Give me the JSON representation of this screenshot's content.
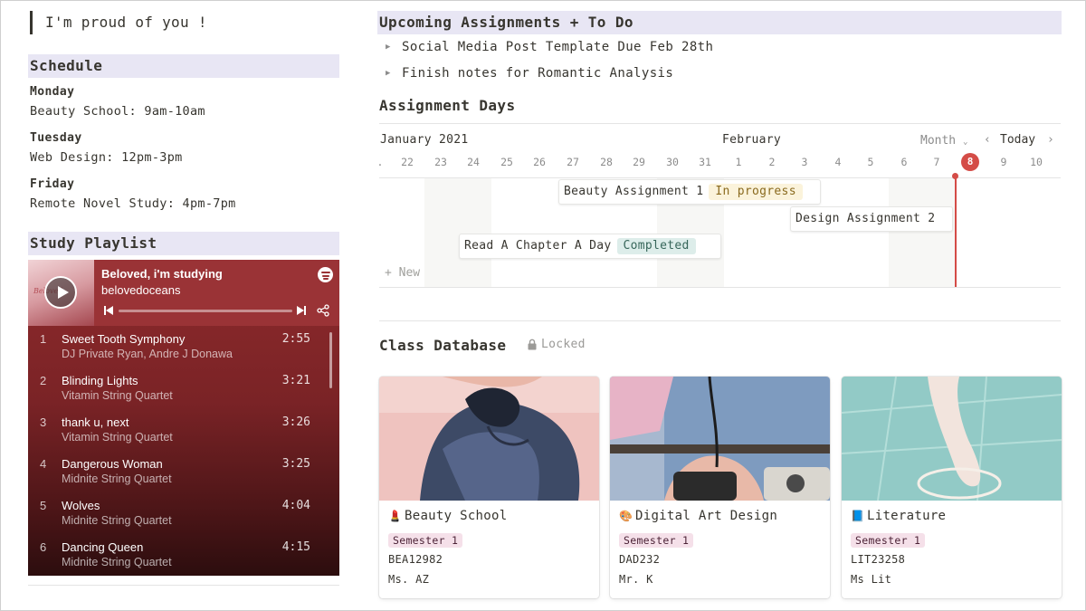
{
  "quote": "I'm proud of you !",
  "schedule": {
    "heading": "Schedule",
    "days": [
      {
        "day": "Monday",
        "slot": "Beauty School: 9am-10am"
      },
      {
        "day": "Tuesday",
        "slot": "Web Design: 12pm-3pm"
      },
      {
        "day": "Friday",
        "slot": "Remote Novel Study: 4pm-7pm"
      }
    ]
  },
  "playlist": {
    "heading": "Study Playlist",
    "title": "Beloved, i'm studying",
    "owner": "belovedoceans",
    "tracks": [
      {
        "num": "1",
        "name": "Sweet Tooth Symphony",
        "artist": "DJ Private Ryan, Andre J Donawa",
        "duration": "2:55"
      },
      {
        "num": "2",
        "name": "Blinding Lights",
        "artist": "Vitamin String Quartet",
        "duration": "3:21"
      },
      {
        "num": "3",
        "name": "thank u, next",
        "artist": "Vitamin String Quartet",
        "duration": "3:26"
      },
      {
        "num": "4",
        "name": "Dangerous Woman",
        "artist": "Midnite String Quartet",
        "duration": "3:25"
      },
      {
        "num": "5",
        "name": "Wolves",
        "artist": "Midnite String Quartet",
        "duration": "4:04"
      },
      {
        "num": "6",
        "name": "Dancing Queen",
        "artist": "Midnite String Quartet",
        "duration": "4:15"
      }
    ]
  },
  "upcoming": {
    "heading": "Upcoming Assignments + To Do",
    "items": [
      "Social Media Post Template Due Feb 28th",
      "Finish notes for Romantic Analysis"
    ]
  },
  "timeline": {
    "heading": "Assignment Days",
    "left_month": "January 2021",
    "right_month": "February",
    "view": "Month",
    "today_label": "Today",
    "dates": [
      "22",
      "23",
      "24",
      "25",
      "26",
      "27",
      "28",
      "29",
      "30",
      "31",
      "1",
      "2",
      "3",
      "4",
      "5",
      "6",
      "7",
      "8",
      "9",
      "10"
    ],
    "today_date": "8",
    "new_label": "+ New",
    "items": [
      {
        "name": "Beauty Assignment 1",
        "status": "In progress"
      },
      {
        "name": "Design Assignment 2",
        "status": ""
      },
      {
        "name": "Read A Chapter A Day",
        "status": "Completed"
      }
    ]
  },
  "classes": {
    "heading": "Class Database",
    "locked_label": "Locked",
    "items": [
      {
        "emoji": "💄",
        "name": "Beauty School",
        "semester": "Semester 1",
        "code": "BEA12982",
        "teacher": "Ms. AZ"
      },
      {
        "emoji": "🎨",
        "name": "Digital Art Design",
        "semester": "Semester 1",
        "code": "DAD232",
        "teacher": "Mr. K"
      },
      {
        "emoji": "📘",
        "name": "Literature",
        "semester": "Semester 1",
        "code": "LIT23258",
        "teacher": "Ms Lit"
      }
    ]
  },
  "colors": {
    "heading_bg": "#e8e6f4",
    "today_red": "#d44c47",
    "player_red": "#9a3336",
    "semester_tag": "#f5e0e9",
    "progress_tag": "#fbf3db",
    "completed_tag": "#ddedea"
  }
}
